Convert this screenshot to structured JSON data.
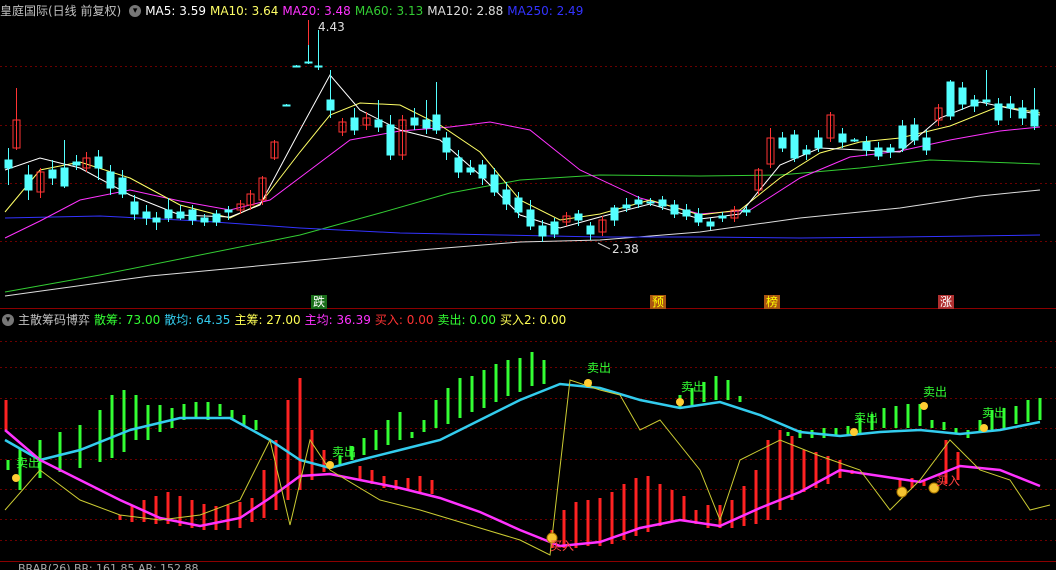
{
  "main": {
    "title": "皇庭国际(日线 前复权)",
    "legends": [
      {
        "label": "MA5: 3.59",
        "color": "#ffffff"
      },
      {
        "label": "MA10: 3.64",
        "color": "#ffff66"
      },
      {
        "label": "MA20: 3.48",
        "color": "#ff33ff"
      },
      {
        "label": "MA60: 3.13",
        "color": "#33cc33"
      },
      {
        "label": "MA120: 2.88",
        "color": "#dddddd"
      },
      {
        "label": "MA250: 2.49",
        "color": "#3333ff"
      }
    ],
    "price_high_label": "4.43",
    "price_low_label": "2.38",
    "markers": [
      {
        "label": "跌",
        "bg": "#1a6f1a",
        "color": "#ffffff"
      },
      {
        "label": "预",
        "bg": "#aa5511",
        "color": "#ffff00"
      },
      {
        "label": "榜",
        "bg": "#aa5511",
        "color": "#ffff00"
      },
      {
        "label": "涨",
        "bg": "#b03030",
        "color": "#ffffff"
      }
    ]
  },
  "indicator": {
    "title": "主散筹码博弈",
    "legends": [
      {
        "label": "散筹: 73.00",
        "color": "#33ff33"
      },
      {
        "label": "散均: 64.35",
        "color": "#33ccee"
      },
      {
        "label": "主筹: 27.00",
        "color": "#ffff55"
      },
      {
        "label": "主均: 36.39",
        "color": "#ff33ff"
      },
      {
        "label": "买入: 0.00",
        "color": "#ff3333"
      },
      {
        "label": "卖出: 0.00",
        "color": "#33ff33"
      },
      {
        "label": "买入2: 0.00",
        "color": "#ffff55"
      }
    ],
    "sell_label": "卖出",
    "buy_label": "买入"
  },
  "footer": {
    "text": "BRAR(26) BR: 161.85 AR: 152.88"
  },
  "colors": {
    "up": "#ff3333",
    "down": "#54ffff",
    "grid": "#8b0000"
  }
}
